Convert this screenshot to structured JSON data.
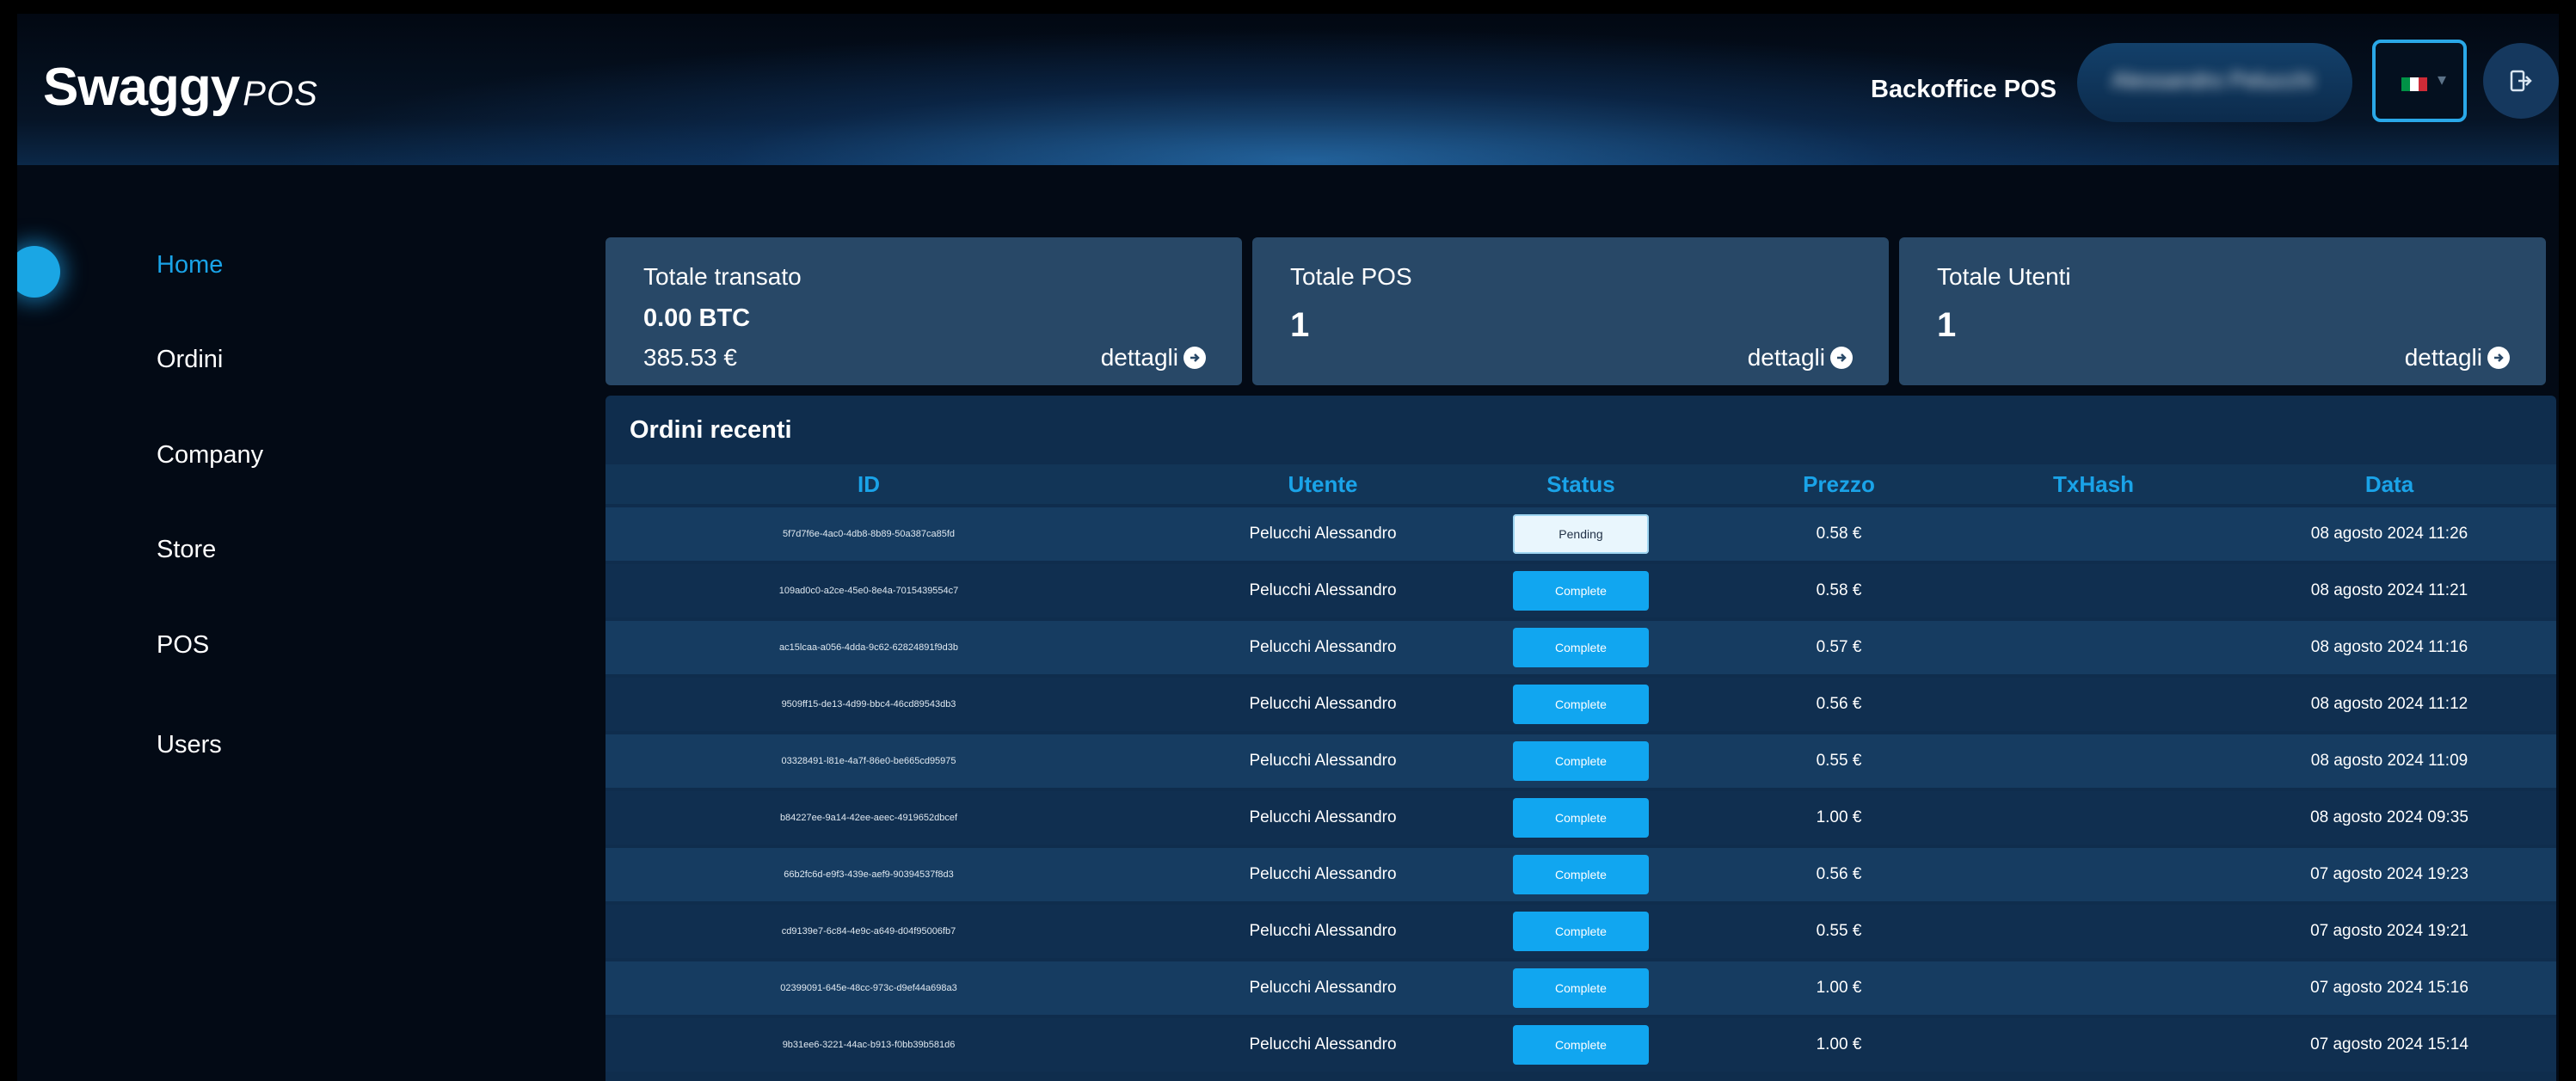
{
  "header": {
    "logo_main": "Swaggy",
    "logo_suffix": "POS",
    "backoffice_label": "Backoffice POS",
    "user_name": "Alessandro Pelucchi",
    "language": "Italiano",
    "flag_colors": [
      "#009246",
      "#ffffff",
      "#ce2b37"
    ],
    "logout_icon": "logout-icon"
  },
  "sidebar": {
    "items": [
      {
        "label": "Home",
        "active": true
      },
      {
        "label": "Ordini",
        "active": false
      },
      {
        "label": "Company",
        "active": false
      },
      {
        "label": "Store",
        "active": false
      },
      {
        "label": "POS",
        "active": false
      },
      {
        "label": "Users",
        "active": false
      }
    ]
  },
  "cards": {
    "transato": {
      "title": "Totale transato",
      "btc": "0.00 BTC",
      "eur": "385.53 €",
      "link": "dettagli"
    },
    "pos": {
      "title": "Totale POS",
      "value": "1",
      "link": "dettagli"
    },
    "utenti": {
      "title": "Totale Utenti",
      "value": "1",
      "link": "dettagli"
    }
  },
  "orders": {
    "title": "Ordini recenti",
    "columns": [
      "ID",
      "Utente",
      "Status",
      "Prezzo",
      "TxHash",
      "Data"
    ],
    "rows": [
      {
        "id": "5f7d7f6e-4ac0-4db8-8b89-50a387ca85fd",
        "user": "Pelucchi Alessandro",
        "status": "Pending",
        "price": "0.58 €",
        "txhash": "",
        "date": "08 agosto 2024 11:26"
      },
      {
        "id": "109ad0c0-a2ce-45e0-8e4a-7015439554c7",
        "user": "Pelucchi Alessandro",
        "status": "Complete",
        "price": "0.58 €",
        "txhash": "",
        "date": "08 agosto 2024 11:21"
      },
      {
        "id": "ac15lcaa-a056-4dda-9c62-62824891f9d3b",
        "user": "Pelucchi Alessandro",
        "status": "Complete",
        "price": "0.57 €",
        "txhash": "",
        "date": "08 agosto 2024 11:16"
      },
      {
        "id": "9509ff15-de13-4d99-bbc4-46cd89543db3",
        "user": "Pelucchi Alessandro",
        "status": "Complete",
        "price": "0.56 €",
        "txhash": "",
        "date": "08 agosto 2024 11:12"
      },
      {
        "id": "03328491-l81e-4a7f-86e0-be665cd95975",
        "user": "Pelucchi Alessandro",
        "status": "Complete",
        "price": "0.55 €",
        "txhash": "",
        "date": "08 agosto 2024 11:09"
      },
      {
        "id": "b84227ee-9a14-42ee-aeec-4919652dbcef",
        "user": "Pelucchi Alessandro",
        "status": "Complete",
        "price": "1.00 €",
        "txhash": "",
        "date": "08 agosto 2024 09:35"
      },
      {
        "id": "66b2fc6d-e9f3-439e-aef9-90394537f8d3",
        "user": "Pelucchi Alessandro",
        "status": "Complete",
        "price": "0.56 €",
        "txhash": "",
        "date": "07 agosto 2024 19:23"
      },
      {
        "id": "cd9139e7-6c84-4e9c-a649-d04f95006fb7",
        "user": "Pelucchi Alessandro",
        "status": "Complete",
        "price": "0.55 €",
        "txhash": "",
        "date": "07 agosto 2024 19:21"
      },
      {
        "id": "02399091-645e-48cc-973c-d9ef44a698a3",
        "user": "Pelucchi Alessandro",
        "status": "Complete",
        "price": "1.00 €",
        "txhash": "",
        "date": "07 agosto 2024 15:16"
      },
      {
        "id": "9b31ee6-3221-44ac-b913-f0bb39b581d6",
        "user": "Pelucchi Alessandro",
        "status": "Complete",
        "price": "1.00 €",
        "txhash": "",
        "date": "07 agosto 2024 15:14"
      }
    ]
  },
  "colors": {
    "accent": "#19a3e8",
    "card_bg": "#284867",
    "panel_bg": "#0f2d4d",
    "complete": "#11a6f0",
    "pending": "#e9f6fd"
  }
}
